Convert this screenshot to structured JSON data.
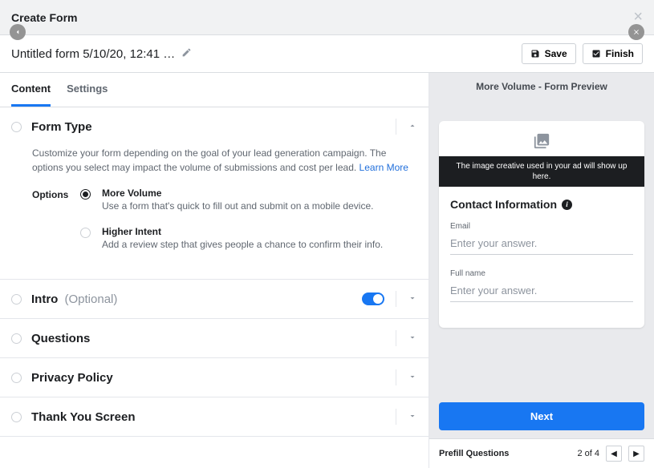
{
  "modal_title": "Create Form",
  "form_name": "Untitled form 5/10/20, 12:41 …",
  "actions": {
    "save": "Save",
    "finish": "Finish"
  },
  "tabs": {
    "content": "Content",
    "settings": "Settings"
  },
  "form_type": {
    "title": "Form Type",
    "desc": "Customize your form depending on the goal of your lead generation campaign. The options you select may impact the volume of submissions and cost per lead. ",
    "learn_more": "Learn More",
    "options_label": "Options",
    "options": [
      {
        "title": "More Volume",
        "desc": "Use a form that's quick to fill out and submit on a mobile device.",
        "selected": true
      },
      {
        "title": "Higher Intent",
        "desc": "Add a review step that gives people a chance to confirm their info.",
        "selected": false
      }
    ]
  },
  "sections": {
    "intro": {
      "title": "Intro",
      "optional": "(Optional)"
    },
    "questions": {
      "title": "Questions"
    },
    "privacy": {
      "title": "Privacy Policy"
    },
    "thank_you": {
      "title": "Thank You Screen"
    }
  },
  "preview": {
    "header": "More Volume - Form Preview",
    "image_notice": "The image creative used in your ad will show up here.",
    "card_title": "Contact Information",
    "fields": [
      {
        "label": "Email",
        "placeholder": "Enter your answer."
      },
      {
        "label": "Full name",
        "placeholder": "Enter your answer."
      }
    ],
    "next": "Next",
    "footer_label": "Prefill Questions",
    "page_indicator": "2 of 4"
  }
}
